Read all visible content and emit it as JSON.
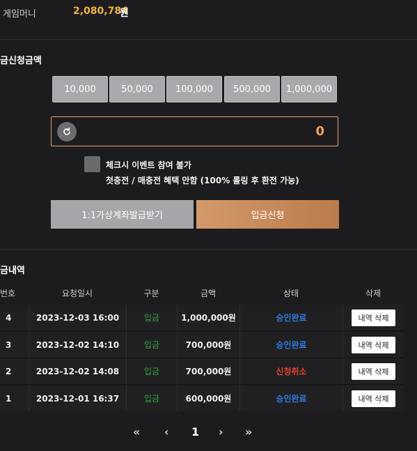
{
  "game_money": {
    "label": "게임머니",
    "value": "2,080,784",
    "unit": "원"
  },
  "deposit_amount": {
    "title": "금신청금액",
    "presets": [
      "10,000",
      "50,000",
      "100,000",
      "500,000",
      "1,000,000"
    ],
    "input_value": "0",
    "checkbox_label": "체크시 이벤트 참여 불가",
    "checkbox_note": "첫충전 / 매충전 혜택 안함 (100% 롤링 후 환전 가능)",
    "virtual_account_button": "1:1가상계좌발급받기",
    "apply_button": "입금신청"
  },
  "history": {
    "title": "금내역",
    "columns": [
      "번호",
      "요청일시",
      "구분",
      "금액",
      "상태",
      "삭제"
    ],
    "rows": [
      {
        "no": "4",
        "datetime": "2023-12-03 16:00",
        "type": "입금",
        "amount": "1,000,000원",
        "status": "승인완료",
        "delete": "내역 삭제"
      },
      {
        "no": "3",
        "datetime": "2023-12-02 14:10",
        "type": "입금",
        "amount": "700,000원",
        "status": "승인완료",
        "delete": "내역 삭제"
      },
      {
        "no": "2",
        "datetime": "2023-12-02 14:08",
        "type": "입금",
        "amount": "700,000원",
        "status": "신청취소",
        "delete": "내역 삭제"
      },
      {
        "no": "1",
        "datetime": "2023-12-01 16:37",
        "type": "입금",
        "amount": "600,000원",
        "status": "승인완료",
        "delete": "내역 삭제"
      }
    ],
    "status_colors": {
      "승인완료": "#2f7be0",
      "신청취소": "#e8412c"
    }
  },
  "pagination": {
    "first": "«",
    "prev": "‹",
    "current": "1",
    "next": "›",
    "last": "»"
  }
}
